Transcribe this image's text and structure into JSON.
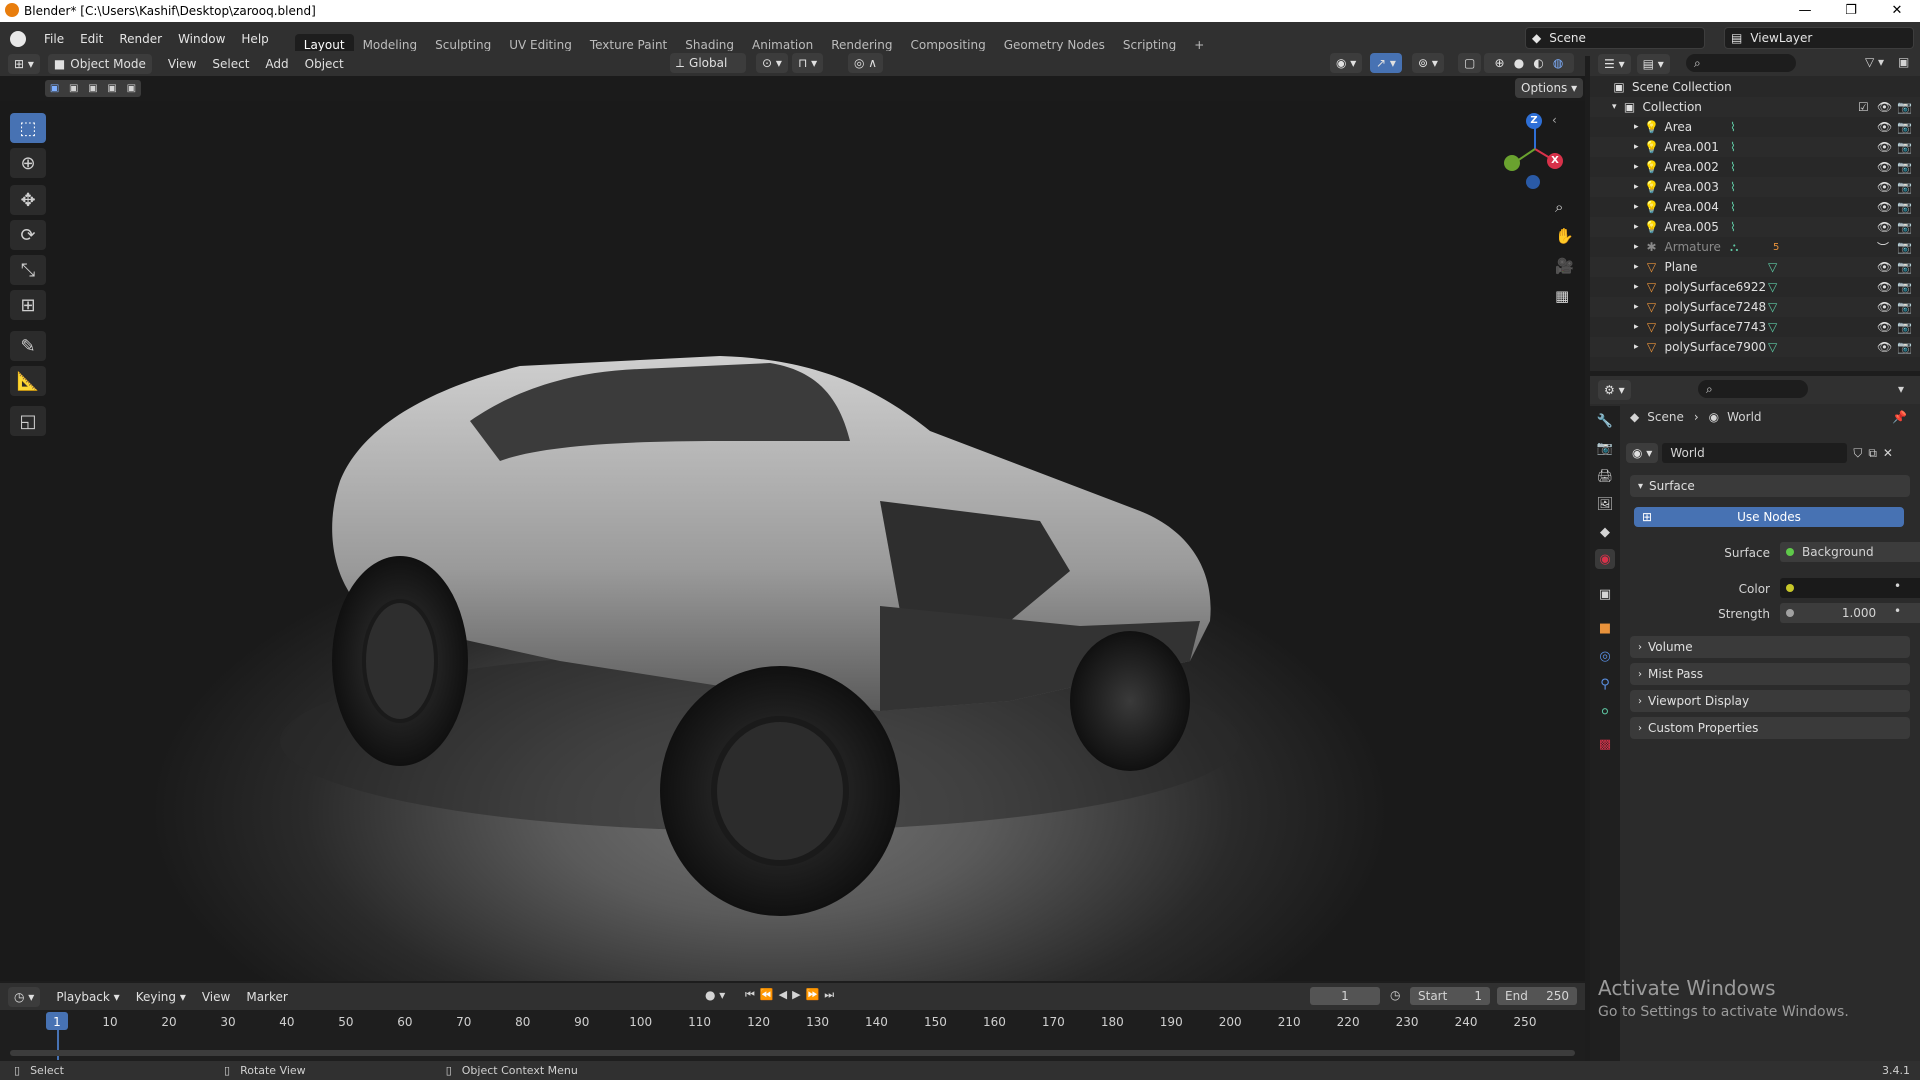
{
  "window": {
    "title": "Blender* [C:\\Users\\Kashif\\Desktop\\zarooq.blend]",
    "minimize": "—",
    "maximize": "❐",
    "close": "✕"
  },
  "menu": [
    "File",
    "Edit",
    "Render",
    "Window",
    "Help"
  ],
  "workspaces": [
    "Layout",
    "Modeling",
    "Sculpting",
    "UV Editing",
    "Texture Paint",
    "Shading",
    "Animation",
    "Rendering",
    "Compositing",
    "Geometry Nodes",
    "Scripting"
  ],
  "active_workspace": "Layout",
  "add_workspace": "+",
  "scene_name": "Scene",
  "view_layer": "ViewLayer",
  "viewport": {
    "mode": "Object Mode",
    "menus": [
      "View",
      "Select",
      "Add",
      "Object"
    ],
    "orientation": "Global",
    "options_label": "Options",
    "gizmo_axes": {
      "z": "Z",
      "x": "X"
    }
  },
  "outliner": {
    "scene_collection": "Scene Collection",
    "collection": "Collection",
    "items": [
      {
        "name": "Area",
        "type": "light"
      },
      {
        "name": "Area.001",
        "type": "light"
      },
      {
        "name": "Area.002",
        "type": "light"
      },
      {
        "name": "Area.003",
        "type": "light"
      },
      {
        "name": "Area.004",
        "type": "light"
      },
      {
        "name": "Area.005",
        "type": "light"
      },
      {
        "name": "Armature",
        "type": "armature",
        "extra": "5"
      },
      {
        "name": "Plane",
        "type": "mesh"
      },
      {
        "name": "polySurface6922",
        "type": "mesh"
      },
      {
        "name": "polySurface7248",
        "type": "mesh"
      },
      {
        "name": "polySurface7743",
        "type": "mesh"
      },
      {
        "name": "polySurface7900",
        "type": "mesh"
      }
    ]
  },
  "properties": {
    "breadcrumb_scene": "Scene",
    "breadcrumb_world": "World",
    "world_name": "World",
    "surface_panel": "Surface",
    "use_nodes": "Use Nodes",
    "surface_label": "Surface",
    "surface_value": "Background",
    "color_label": "Color",
    "strength_label": "Strength",
    "strength_value": "1.000",
    "panels": [
      "Volume",
      "Mist Pass",
      "Viewport Display",
      "Custom Properties"
    ]
  },
  "timeline": {
    "menus": [
      "Playback",
      "Keying",
      "View",
      "Marker"
    ],
    "current_frame": "1",
    "start_label": "Start",
    "start_value": "1",
    "end_label": "End",
    "end_value": "250",
    "ticks": [
      "1",
      "10",
      "20",
      "30",
      "40",
      "50",
      "60",
      "70",
      "80",
      "90",
      "100",
      "110",
      "120",
      "130",
      "140",
      "150",
      "160",
      "170",
      "180",
      "190",
      "200",
      "210",
      "220",
      "230",
      "240",
      "250"
    ]
  },
  "status": {
    "select": "Select",
    "rotate_view": "Rotate View",
    "context_menu": "Object Context Menu",
    "version": "3.4.1"
  },
  "watermark": {
    "title": "Activate Windows",
    "subtitle": "Go to Settings to activate Windows."
  },
  "colors": {
    "accent": "#4772b3",
    "light_icon": "#e8923b",
    "mesh_icon": "#e8923b",
    "data_icon": "#5fc9a4"
  }
}
